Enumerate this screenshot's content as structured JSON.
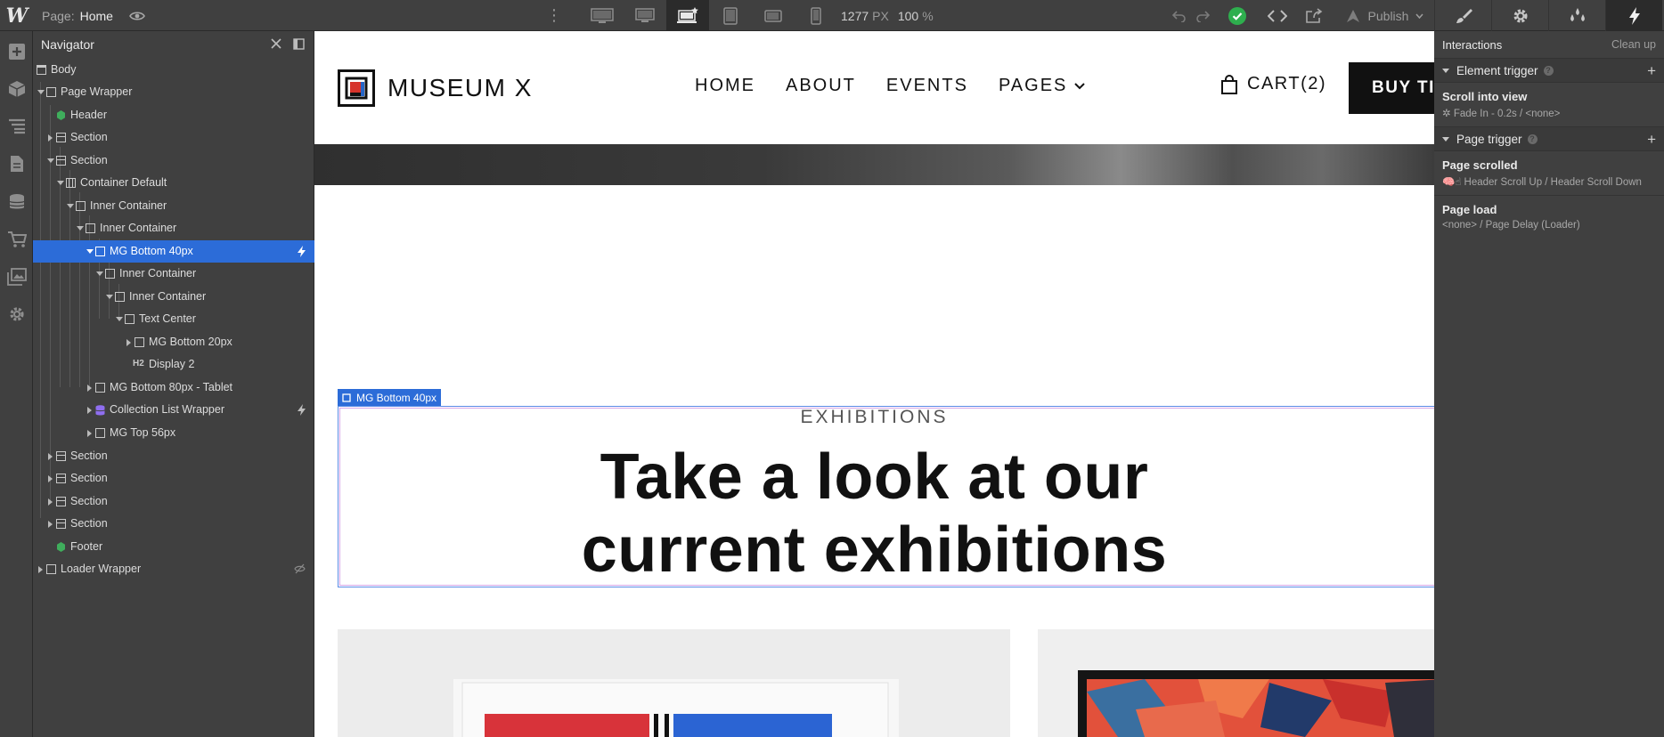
{
  "topbar": {
    "logo": "W",
    "page_label": "Page:",
    "page_name": "Home",
    "width_value": "1277",
    "width_unit": "PX",
    "zoom_value": "100",
    "zoom_unit": "%",
    "publish_label": "Publish"
  },
  "navigator": {
    "title": "Navigator",
    "items": [
      {
        "label": "Body"
      },
      {
        "label": "Page Wrapper"
      },
      {
        "label": "Header"
      },
      {
        "label": "Section"
      },
      {
        "label": "Section"
      },
      {
        "label": "Container Default"
      },
      {
        "label": "Inner Container"
      },
      {
        "label": "Inner Container"
      },
      {
        "label": "MG Bottom 40px"
      },
      {
        "label": "Inner Container"
      },
      {
        "label": "Inner Container"
      },
      {
        "label": "Text Center"
      },
      {
        "label": "MG Bottom 20px"
      },
      {
        "label": "Display 2"
      },
      {
        "label": "MG Bottom 80px - Tablet"
      },
      {
        "label": "Collection List Wrapper"
      },
      {
        "label": "MG Top 56px"
      },
      {
        "label": "Section"
      },
      {
        "label": "Section"
      },
      {
        "label": "Section"
      },
      {
        "label": "Section"
      },
      {
        "label": "Footer"
      },
      {
        "label": "Loader Wrapper"
      }
    ],
    "h2_tag": "H2"
  },
  "site": {
    "brand": "MUSEUM X",
    "menu": [
      "HOME",
      "ABOUT",
      "EVENTS",
      "PAGES"
    ],
    "cart": "CART(2)",
    "cta": "BUY TICKETS",
    "selected_tag": "MG Bottom 40px",
    "eyebrow": "EXHIBITIONS",
    "headline_line1": "Take a look at our",
    "headline_line2": "current exhibitions"
  },
  "interactions": {
    "title": "Interactions",
    "clean_up": "Clean up",
    "element_trigger": "Element trigger",
    "scroll_into_view": "Scroll into view",
    "scroll_detail": "Fade In - 0.2s / <none>",
    "page_trigger": "Page trigger",
    "page_scrolled": "Page scrolled",
    "page_scrolled_detail": "Header Scroll Up / Header Scroll Down",
    "page_load": "Page load",
    "page_load_detail": "<none> / Page Delay (Loader)"
  },
  "colors": {
    "accent_blue": "#2c6cd8",
    "publish_green": "#2eaf4e",
    "panel_bg": "#404040"
  }
}
